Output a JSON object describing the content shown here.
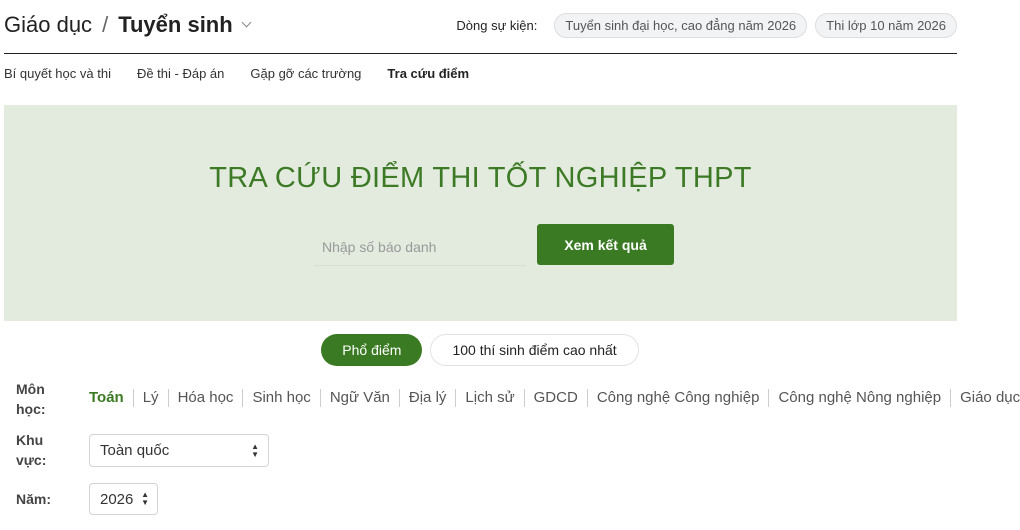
{
  "breadcrumb": {
    "parent": "Giáo dục",
    "separator": "/",
    "current": "Tuyển sinh"
  },
  "events": {
    "label": "Dòng sự kiện:",
    "chips": [
      "Tuyển sinh đại học, cao đẳng năm 2026",
      "Thi lớp 10 năm 2026"
    ]
  },
  "subnav": {
    "items": [
      "Bí quyết học và thi",
      "Đề thi - Đáp án",
      "Gặp gỡ các trường",
      "Tra cứu điểm"
    ],
    "active_index": 3
  },
  "hero": {
    "title": "TRA CỨU ĐIỂM THI TỐT NGHIỆP THPT",
    "input_placeholder": "Nhập số báo danh",
    "submit_label": "Xem kết quả"
  },
  "tabs": [
    {
      "label": "Phổ điểm",
      "active": true
    },
    {
      "label": "100 thí sinh điểm cao nhất",
      "active": false
    }
  ],
  "filters": {
    "subject_label": [
      "Môn",
      "học:"
    ],
    "subjects": [
      "Toán",
      "Lý",
      "Hóa học",
      "Sinh học",
      "Ngữ Văn",
      "Địa lý",
      "Lịch sử",
      "GDCD",
      "Công nghệ Công nghiệp",
      "Công nghệ Nông nghiệp",
      "Giáo dục"
    ],
    "region_label": [
      "Khu",
      "vực:"
    ],
    "region_value": "Toàn quốc",
    "year_label": "Năm:",
    "year_value": "2026"
  },
  "colors": {
    "accent": "#3a7a23",
    "hero_bg": "#e3ebdf",
    "title_green": "#3c7a25"
  }
}
